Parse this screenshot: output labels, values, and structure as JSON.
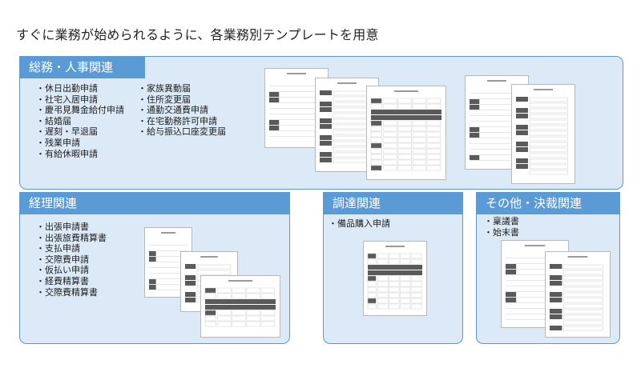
{
  "headline": "すぐに業務が始められるように、各業務別テンプレートを用意",
  "sections": {
    "general_affairs": {
      "title": "総務・人事関連",
      "col1": [
        "休日出勤申請",
        "社宅入居申請",
        "慶弔見舞金給付申請",
        "結婚届",
        "遅刻・早退届",
        "残業申請",
        "有給休暇申請"
      ],
      "col2": [
        "家族異動届",
        "住所変更届",
        "通勤交通費申請",
        "在宅勤務許可申請",
        "給与振込口座変更届"
      ]
    },
    "accounting": {
      "title": "経理関連",
      "items": [
        "出張申請書",
        "出張旅費精算書",
        "支払申請",
        "交際費申請",
        "仮払い申請",
        "経費精算書",
        "交際費精算書"
      ]
    },
    "procurement": {
      "title": "調達関連",
      "items": [
        "備品購入申請"
      ]
    },
    "other": {
      "title": "その他・決裁関連",
      "items": [
        "稟議書",
        "始末書"
      ]
    }
  },
  "colors": {
    "panel_bg": "#dce9f7",
    "panel_border": "#5f95d0",
    "header_bg": "#5b9bd5",
    "form_cell": "#5a5a5a"
  }
}
